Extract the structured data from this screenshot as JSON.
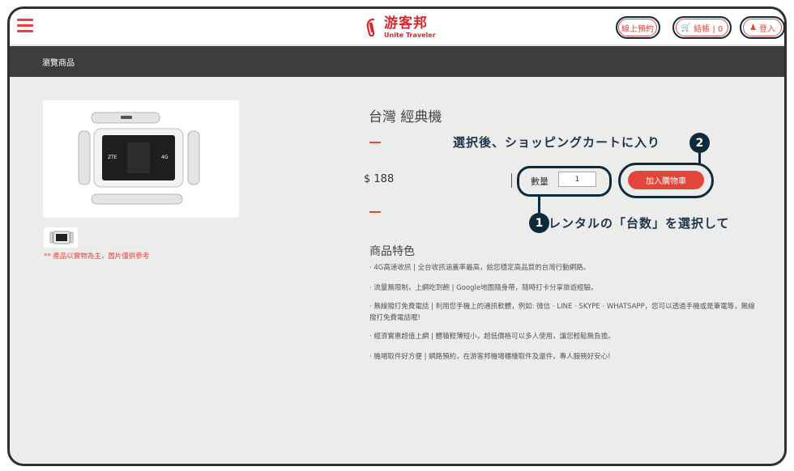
{
  "header": {
    "logo_cn": "游客邦",
    "logo_en": "Unite Traveler",
    "reserve_label": "線上預約",
    "cart_label": "結帳 | 0",
    "login_label": "登入"
  },
  "subnav": {
    "label": "瀏覽商品"
  },
  "product": {
    "title": "台灣 經典機",
    "price": "$ 188",
    "quantity_label": "數量",
    "quantity_value": "1",
    "add_to_cart_label": "加入購物車",
    "image_note": "** 產品以實物為主，圖片僅供參考",
    "device_labels": [
      "ZTE",
      "4G"
    ]
  },
  "features": {
    "title": "商品特色",
    "items": [
      "· 4G高速收訊 | 全台收訊涵蓋率最高，給您穩定高品質的台灣行動網路。",
      "· 流量無限制，上網吃到飽 | Google地圖隨身帶，隨時打卡分享旅遊經驗。",
      "· 無線撥打免費電話 | 利用您手機上的通訊軟體，例如: 微信 · LINE · SKYPE · WHATSAPP，您可以透過手機或是筆電等，無線撥打免費電話喔!",
      "· 經濟實惠超值上網 | 體積輕薄短小，超低價格可以多人使用，讓您輕鬆無負擔。",
      "· 機場取件好方便 | 網路預約，在游客邦機場櫃檯取件及還件，專人服務好安心!"
    ]
  },
  "annotations": {
    "step1_number": "1",
    "step1_text": "レンタルの「台数」を選択して",
    "step2_number": "2",
    "step2_text": "選択後、ショッピングカートに入り"
  },
  "colors": {
    "accent": "#e2463a",
    "annotation": "#0d2a3d",
    "subbar": "#3d3d3d",
    "background": "#ececea"
  }
}
